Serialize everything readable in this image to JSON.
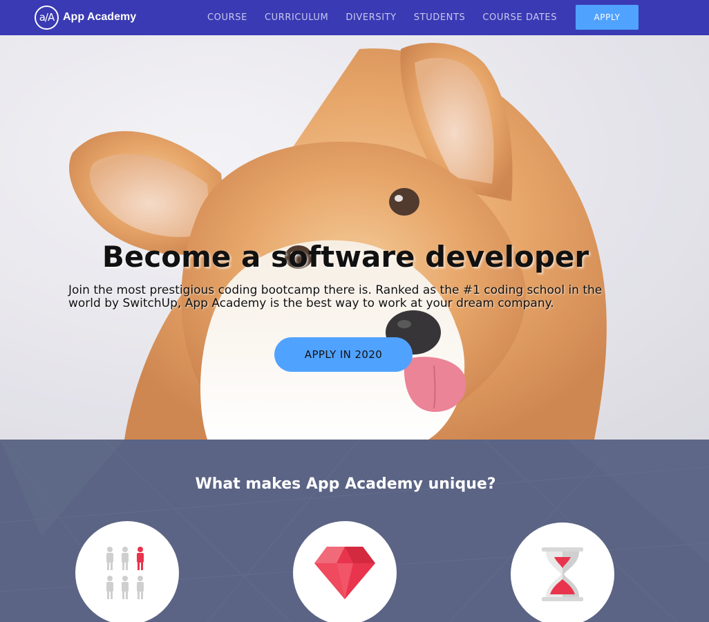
{
  "brand": {
    "name": "App Academy",
    "mark": "a/A"
  },
  "nav": {
    "links": [
      "COURSE",
      "CURRICULUM",
      "DIVERSITY",
      "STUDENTS",
      "COURSE DATES"
    ],
    "apply_label": "APPLY"
  },
  "hero": {
    "title": "Become a software developer",
    "subtitle_line1": "Join the most prestigious coding bootcamp there is. Ranked as the #1 coding school in the",
    "subtitle_line2": "world by SwitchUp, App Academy is the best way to work at your dream company.",
    "cta_label": "APPLY IN 2020",
    "image": "corgi-dog-photo"
  },
  "unique": {
    "title": "What makes App Academy unique?",
    "features": [
      {
        "icon": "people-group-icon"
      },
      {
        "icon": "ruby-gem-icon"
      },
      {
        "icon": "hourglass-icon"
      }
    ]
  },
  "colors": {
    "nav_bg": "#3a3ab4",
    "accent": "#50a2ff",
    "section_bg": "#5b6484",
    "icon_red": "#e8344c"
  }
}
